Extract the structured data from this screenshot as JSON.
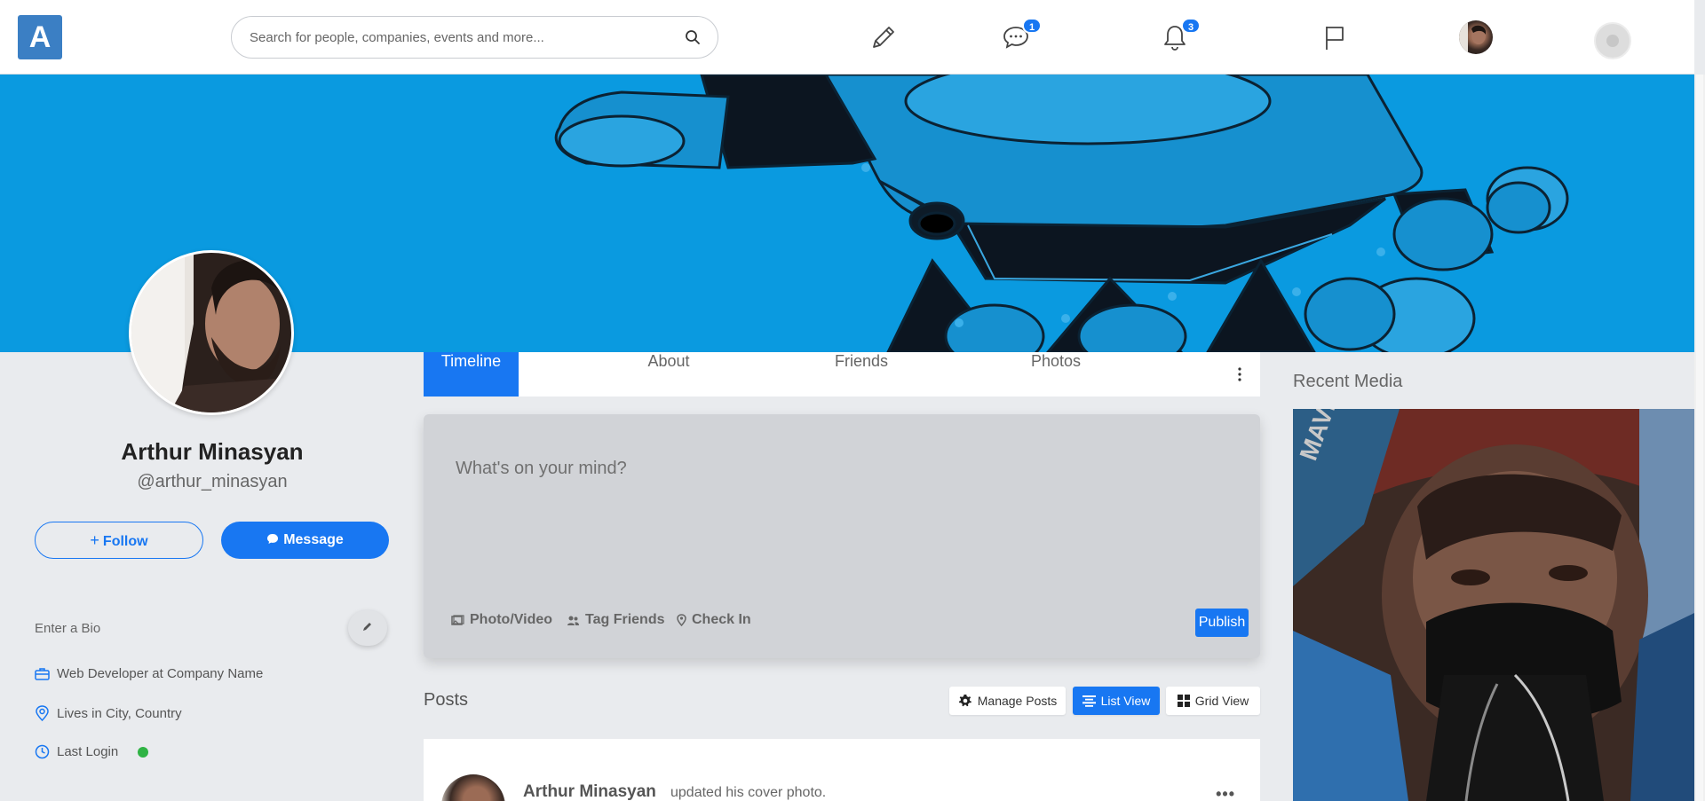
{
  "app": {
    "logo_letter": "A"
  },
  "search": {
    "placeholder": "Search for people, companies, events and more..."
  },
  "nav": {
    "messages_badge": "1",
    "notifications_badge": "3"
  },
  "profile": {
    "name": "Arthur Minasyan",
    "handle": "@arthur_minasyan",
    "follow_label": "Follow",
    "message_label": "Message",
    "bio_placeholder": "Enter a Bio",
    "work": "Web Developer at Company Name",
    "location": "Lives in City, Country",
    "last_login_label": "Last Login",
    "online": true
  },
  "tabs": [
    {
      "label": "Timeline",
      "active": true
    },
    {
      "label": "About",
      "active": false
    },
    {
      "label": "Friends",
      "active": false
    },
    {
      "label": "Photos",
      "active": false
    }
  ],
  "composer": {
    "placeholder": "What's on your mind?",
    "actions": [
      "Photo/Video",
      "Tag Friends",
      "Check In"
    ],
    "publish_label": "Publish"
  },
  "posts": {
    "title": "Posts",
    "manage_label": "Manage Posts",
    "list_view_label": "List View",
    "grid_view_label": "Grid View",
    "active_view": "List View",
    "items": [
      {
        "author": "Arthur Minasyan",
        "action": "updated his cover photo."
      }
    ]
  },
  "sidebar_right": {
    "recent_media_title": "Recent Media"
  },
  "colors": {
    "primary": "#1877f2",
    "cover_blue": "#0a9ae0",
    "online": "#2fb344",
    "logo_bg": "#3b7fc4"
  },
  "icons": [
    "search-icon",
    "pencil-icon",
    "chat-bubble-icon",
    "bell-icon",
    "flag-icon",
    "briefcase-icon",
    "location-pin-icon",
    "clock-icon",
    "gear-icon",
    "list-icon",
    "grid-icon",
    "photo-icon",
    "tag-friends-icon",
    "check-in-pin-icon",
    "kebab-menu-icon"
  ]
}
